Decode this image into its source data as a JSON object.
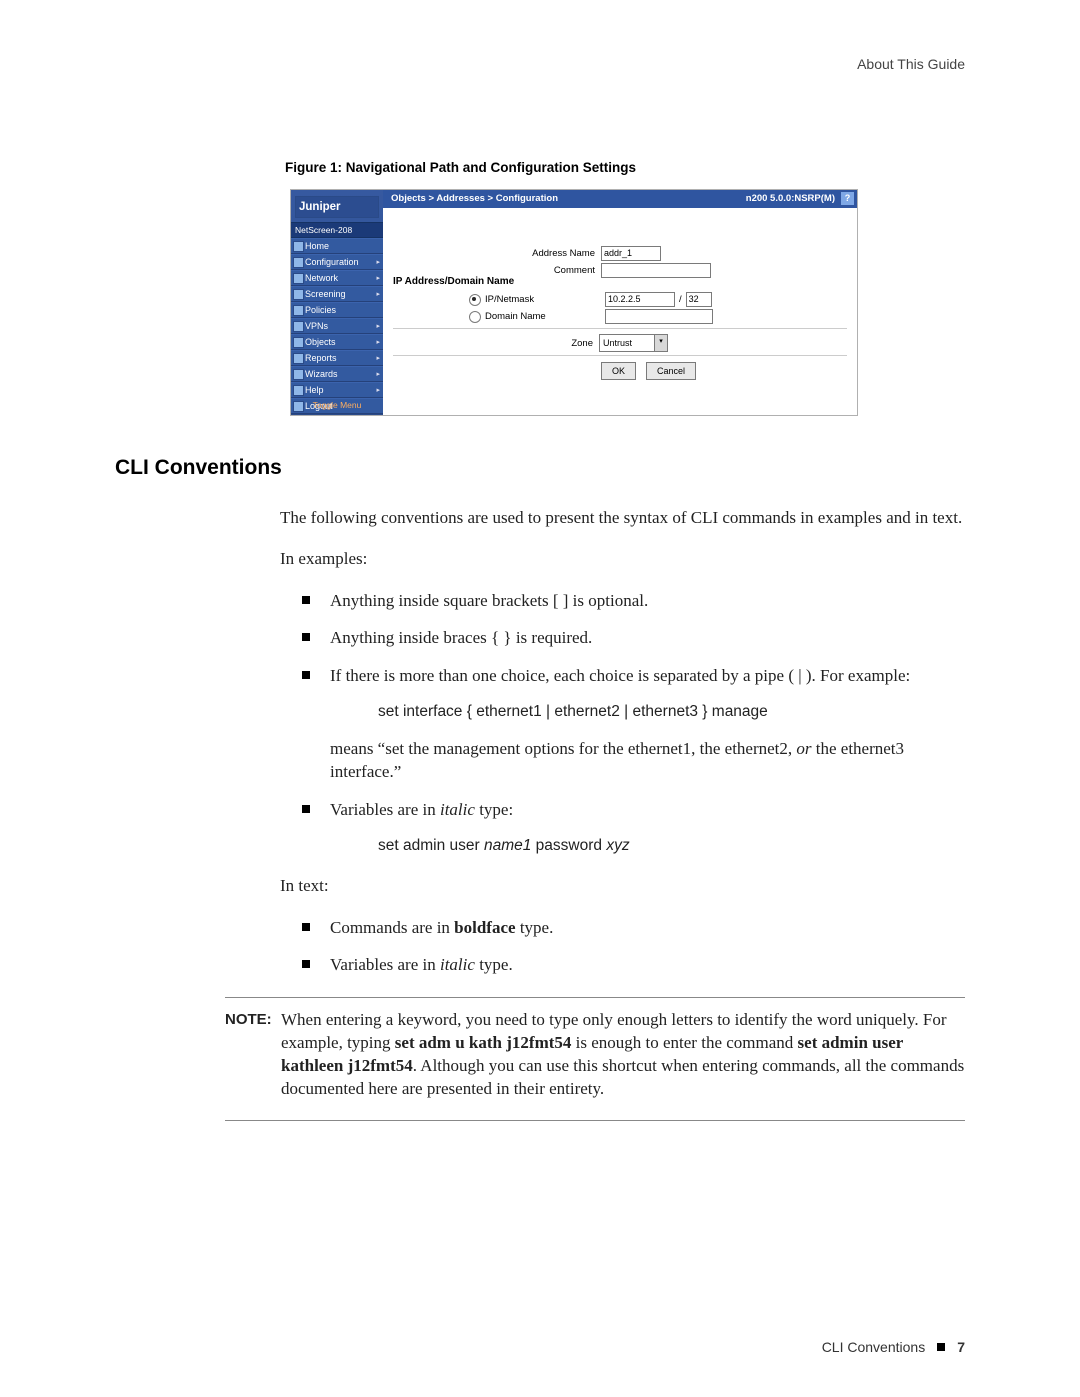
{
  "header": {
    "right": "About This Guide"
  },
  "figure": {
    "caption": "Figure 1:  Navigational Path and Configuration Settings"
  },
  "screenshot": {
    "logo": "Juniper",
    "device": "NetScreen-208",
    "nav": [
      {
        "label": "Home",
        "arrow": false
      },
      {
        "label": "Configuration",
        "arrow": true
      },
      {
        "label": "Network",
        "arrow": true
      },
      {
        "label": "Screening",
        "arrow": true
      },
      {
        "label": "Policies",
        "arrow": false
      },
      {
        "label": "VPNs",
        "arrow": true
      },
      {
        "label": "Objects",
        "arrow": true
      },
      {
        "label": "Reports",
        "arrow": true
      },
      {
        "label": "Wizards",
        "arrow": true
      },
      {
        "label": "Help",
        "arrow": true
      },
      {
        "label": "Logout",
        "arrow": false
      }
    ],
    "toggle": "Toggle Menu",
    "breadcrumb": "Objects > Addresses > Configuration",
    "version": "n200  5.0.0:NSRP(M)",
    "help_icon": "?",
    "fields": {
      "address_name_label": "Address Name",
      "address_name_value": "addr_1",
      "comment_label": "Comment",
      "comment_value": "",
      "section_title": "IP Address/Domain Name",
      "radio_ip_label": "IP/Netmask",
      "ip_value": "10.2.2.5",
      "mask_sep": "/",
      "mask_value": "32",
      "radio_domain_label": "Domain Name",
      "domain_value": "",
      "zone_label": "Zone",
      "zone_value": "Untrust"
    },
    "buttons": {
      "ok": "OK",
      "cancel": "Cancel"
    }
  },
  "section_title": "CLI Conventions",
  "p1": "The following conventions are used to present the syntax of CLI commands in examples and in text.",
  "p2": "In examples:",
  "ex": {
    "b1": "Anything inside square brackets [ ] is optional.",
    "b2": "Anything inside braces { } is required.",
    "b3a": "If there is more than one choice, each choice is separated by a pipe ( | ). For example:",
    "code1": "set interface { ethernet1 | ethernet2 | ethernet3 } manage",
    "b3b_pre": "means “set the management options for the ethernet1, the ethernet2, ",
    "b3b_or": "or",
    "b3b_post": " the ethernet3 interface.”",
    "b4_pre": "Variables are in ",
    "b4_it": "italic",
    "b4_post": " type:",
    "code2_a": "set admin user ",
    "code2_b": "name1",
    "code2_c": " password ",
    "code2_d": "xyz"
  },
  "p3": "In text:",
  "tx": {
    "b1_pre": "Commands are in ",
    "b1_bold": "boldface",
    "b1_post": " type.",
    "b2_pre": "Variables are in ",
    "b2_it": "italic",
    "b2_post": " type."
  },
  "note": {
    "label": "NOTE:",
    "a": "When entering a keyword, you need to type only enough letters to identify the word uniquely. For example, typing ",
    "b": "set adm u kath j12fmt54",
    "c": " is enough to enter the command ",
    "d": "set admin user kathleen j12fmt54",
    "e": ". Although you can use this shortcut when entering commands, all the commands documented here are presented in their entirety."
  },
  "footer": {
    "text": "CLI Conventions",
    "page": "7"
  }
}
